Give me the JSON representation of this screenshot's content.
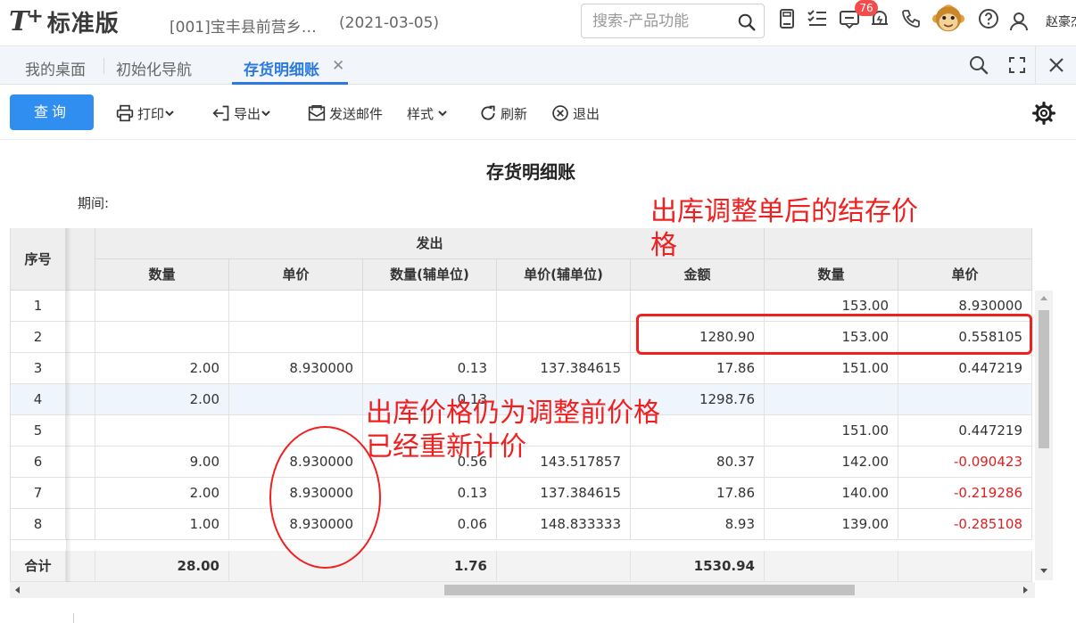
{
  "app": {
    "logo_t": "T",
    "logo_plus": "+",
    "logo_name": "标准版",
    "account": "[001]宝丰县前营乡…",
    "account_date": "(2021-03-05)",
    "search_placeholder": "搜索-产品功能",
    "notification_count": "76",
    "username": "赵豪杰",
    "icons": [
      "calculator-icon",
      "checklist-icon",
      "message-icon",
      "bell-icon",
      "phone-icon",
      "monkey-avatar-icon",
      "help-icon",
      "user-icon"
    ]
  },
  "tabs": {
    "items": [
      "我的桌面",
      "初始化导航",
      "存货明细账"
    ],
    "active": "存货明细账",
    "close_glyph": "✕"
  },
  "toolbar": {
    "query": "查询",
    "print": "打印",
    "export": "导出",
    "email": "发送邮件",
    "style": "样式",
    "refresh": "刷新",
    "exit": "退出"
  },
  "report": {
    "title": "存货明细账",
    "period_label": "期间:"
  },
  "table": {
    "index_header": "序号",
    "group_out": "发出",
    "columns": [
      "数量",
      "单价",
      "数量(辅单位)",
      "单价(辅单位)",
      "金额",
      "数量",
      "单价"
    ],
    "rows": [
      {
        "idx": "1",
        "c1": "",
        "c2": "",
        "c3": "",
        "c4": "",
        "c5": "",
        "c6": "153.00",
        "c7": "8.930000"
      },
      {
        "idx": "2",
        "c1": "",
        "c2": "",
        "c3": "",
        "c4": "",
        "c5": "1280.90",
        "c6": "153.00",
        "c7": "0.558105"
      },
      {
        "idx": "3",
        "c1": "2.00",
        "c2": "8.930000",
        "c3": "0.13",
        "c4": "137.384615",
        "c5": "17.86",
        "c6": "151.00",
        "c7": "0.447219"
      },
      {
        "idx": "4",
        "c1": "2.00",
        "c2": "",
        "c3": "0.13",
        "c4": "",
        "c5": "1298.76",
        "c6": "",
        "c7": ""
      },
      {
        "idx": "5",
        "c1": "",
        "c2": "",
        "c3": "",
        "c4": "",
        "c5": "",
        "c6": "151.00",
        "c7": "0.447219"
      },
      {
        "idx": "6",
        "c1": "9.00",
        "c2": "8.930000",
        "c3": "0.56",
        "c4": "143.517857",
        "c5": "80.37",
        "c6": "142.00",
        "c7": "-0.090423"
      },
      {
        "idx": "7",
        "c1": "2.00",
        "c2": "8.930000",
        "c3": "0.13",
        "c4": "137.384615",
        "c5": "17.86",
        "c6": "140.00",
        "c7": "-0.219286"
      },
      {
        "idx": "8",
        "c1": "1.00",
        "c2": "8.930000",
        "c3": "0.06",
        "c4": "148.833333",
        "c5": "8.93",
        "c6": "139.00",
        "c7": "-0.285108"
      }
    ],
    "total": {
      "label": "合计",
      "c1": "28.00",
      "c2": "",
      "c3": "1.76",
      "c4": "",
      "c5": "1530.94",
      "c6": "",
      "c7": ""
    }
  },
  "annotations": {
    "top_line1": "出库调整单后的结存价",
    "top_line2": "格",
    "mid_line1": "出库价格仍为调整前价格",
    "mid_line2": "已经重新计价",
    "color": "#f02020"
  },
  "colors": {
    "accent": "#2a7ae2",
    "query_button": "#2f8ef0",
    "negative": "#e02020",
    "badge": "#f24c4c"
  }
}
